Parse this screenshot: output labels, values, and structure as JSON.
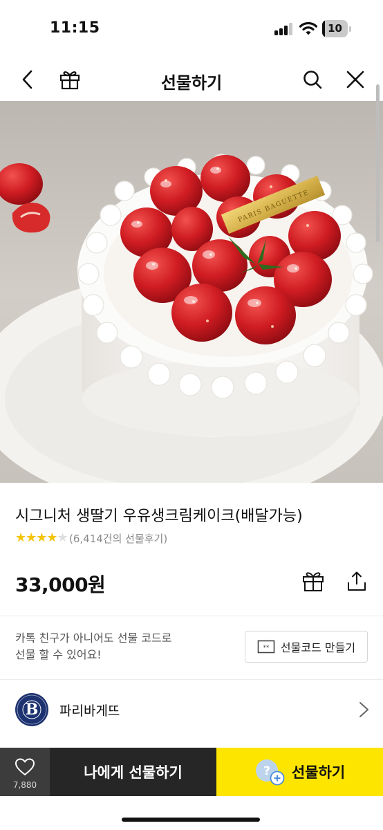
{
  "status_bar": {
    "time": "11:15",
    "battery_level": "10",
    "battery_fraction": 0.1
  },
  "nav": {
    "title": "선물하기",
    "icons": [
      "back-arrow-icon",
      "gift-icon",
      "search-icon",
      "close-icon"
    ]
  },
  "product": {
    "title": "시그니처 생딸기 우유생크림케이크(배달가능)",
    "rating_fraction": 0.8,
    "review_count": "(6,414건의 선물후기)",
    "price": "33,000원",
    "image_text": "PARIS BAGUETTE"
  },
  "gift_code": {
    "note_line1": "카톡 친구가 아니어도 선물 코드로",
    "note_line2": "선물 할 수 있어요!",
    "button_label": "선물코드 만들기"
  },
  "brand": {
    "name": "파리바게뜨",
    "logo_letter": "B"
  },
  "bottom_bar": {
    "wish_count": "7,880",
    "self_gift_label": "나에게 선물하기",
    "gift_label": "선물하기"
  },
  "colors": {
    "accent_yellow": "#fee500",
    "dark_button": "#262626",
    "star": "#f5c400",
    "brand_navy": "#1d3270"
  }
}
